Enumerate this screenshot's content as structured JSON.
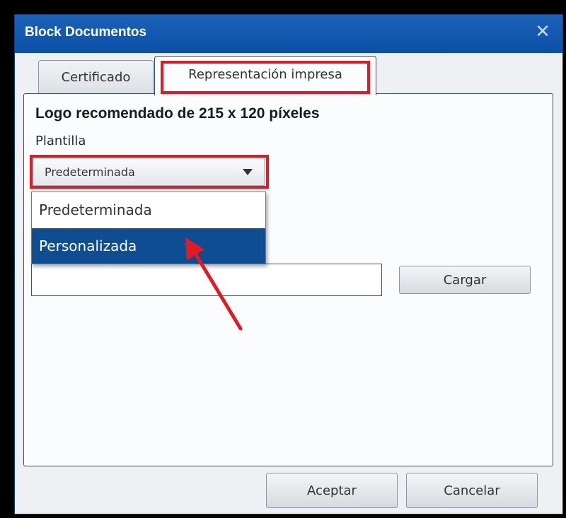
{
  "window": {
    "title": "Block Documentos"
  },
  "tabs": [
    {
      "label": "Certificado"
    },
    {
      "label": "Representación impresa"
    }
  ],
  "panel": {
    "heading": "Logo recomendado de 215 x 120 píxeles",
    "plantilla_label": "Plantilla",
    "select": {
      "value": "Predeterminada",
      "options": [
        "Predeterminada",
        "Personalizada"
      ]
    },
    "cargar_label": "Cargar"
  },
  "footer": {
    "aceptar_label": "Aceptar",
    "cancelar_label": "Cancelar"
  },
  "colors": {
    "titlebar": "#0b4fa6",
    "highlight": "#e11a24",
    "selected_option": "#0f4d92"
  }
}
